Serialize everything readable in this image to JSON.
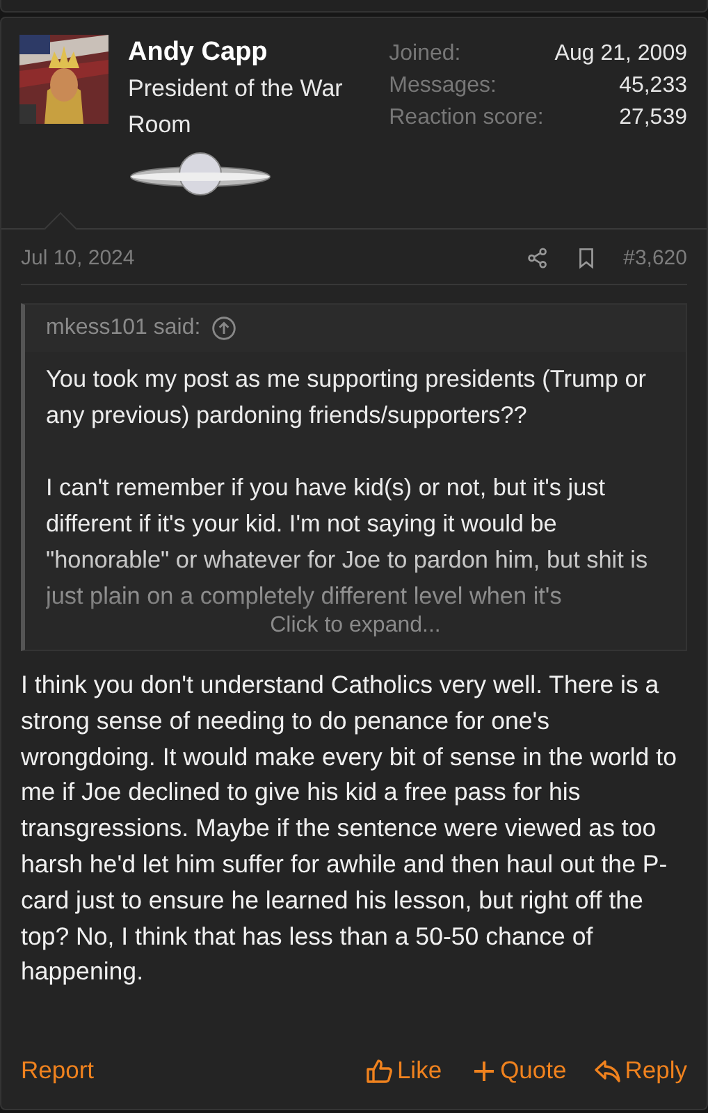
{
  "author": {
    "name": "Andy Capp",
    "title": "President of the War Room"
  },
  "stats": [
    {
      "label": "Joined:",
      "value": "Aug 21, 2009"
    },
    {
      "label": "Messages:",
      "value": "45,233"
    },
    {
      "label": "Reaction score:",
      "value": "27,539"
    }
  ],
  "post": {
    "date": "Jul 10, 2024",
    "number": "#3,620"
  },
  "quote": {
    "author": "mkess101 said:",
    "paragraphs": [
      "You took my post as me supporting presidents (Trump or any previous) pardoning friends/supporters??",
      "I can't remember if you have kid(s) or not, but it's just different if it's your kid. I'm not saying it would be \"honorable\" or whatever for Joe to pardon him, but shit is just plain on a completely different level when it's"
    ],
    "expand": "Click to expand..."
  },
  "body": "I think you don't understand Catholics very well. There is a strong sense of needing to do penance for one's wrongdoing. It would make every bit of sense in the world to me if Joe declined to give his kid a free pass for his transgressions. Maybe if the sentence were viewed as too harsh he'd let him suffer for awhile and then haul out the P-card just to ensure he learned his lesson, but right off the top? No, I think that has less than a 50-50 chance of happening.",
  "actions": {
    "report": "Report",
    "buttons": [
      {
        "kind": "like",
        "label": "Like"
      },
      {
        "kind": "quote",
        "label": "Quote"
      },
      {
        "kind": "reply",
        "label": "Reply"
      }
    ]
  }
}
